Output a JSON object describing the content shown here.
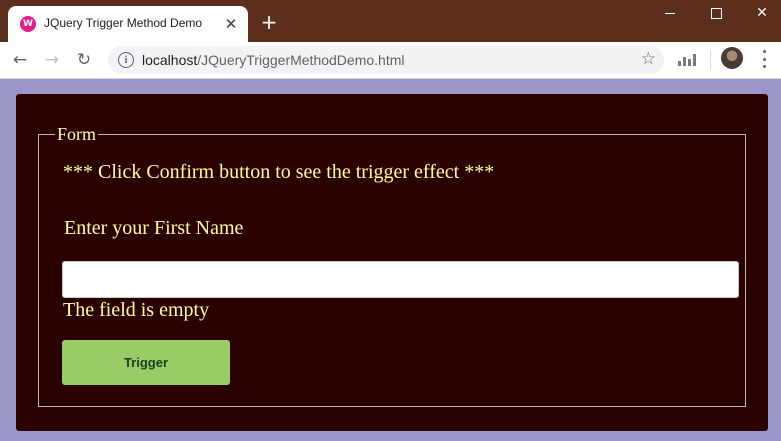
{
  "browser": {
    "tab_title": "JQuery Trigger Method Demo",
    "favicon_letter": "W",
    "url_host": "localhost",
    "url_path": "/JQueryTriggerMethodDemo.html",
    "new_tab_label": "+",
    "close_tab_label": "✕",
    "window_close_label": "✕"
  },
  "form": {
    "legend": "Form",
    "hint": "*** Click Confirm button to see the trigger effect ***",
    "first_name_label": "Enter your First Name",
    "first_name_value": "",
    "status_text": "The field is empty",
    "trigger_button": "Trigger"
  },
  "colors": {
    "titlebar": "#5b2f1c",
    "page_background": "#9b97c8",
    "panel_background": "#2b0000",
    "text": "#ffff99",
    "button": "#99cc66"
  }
}
